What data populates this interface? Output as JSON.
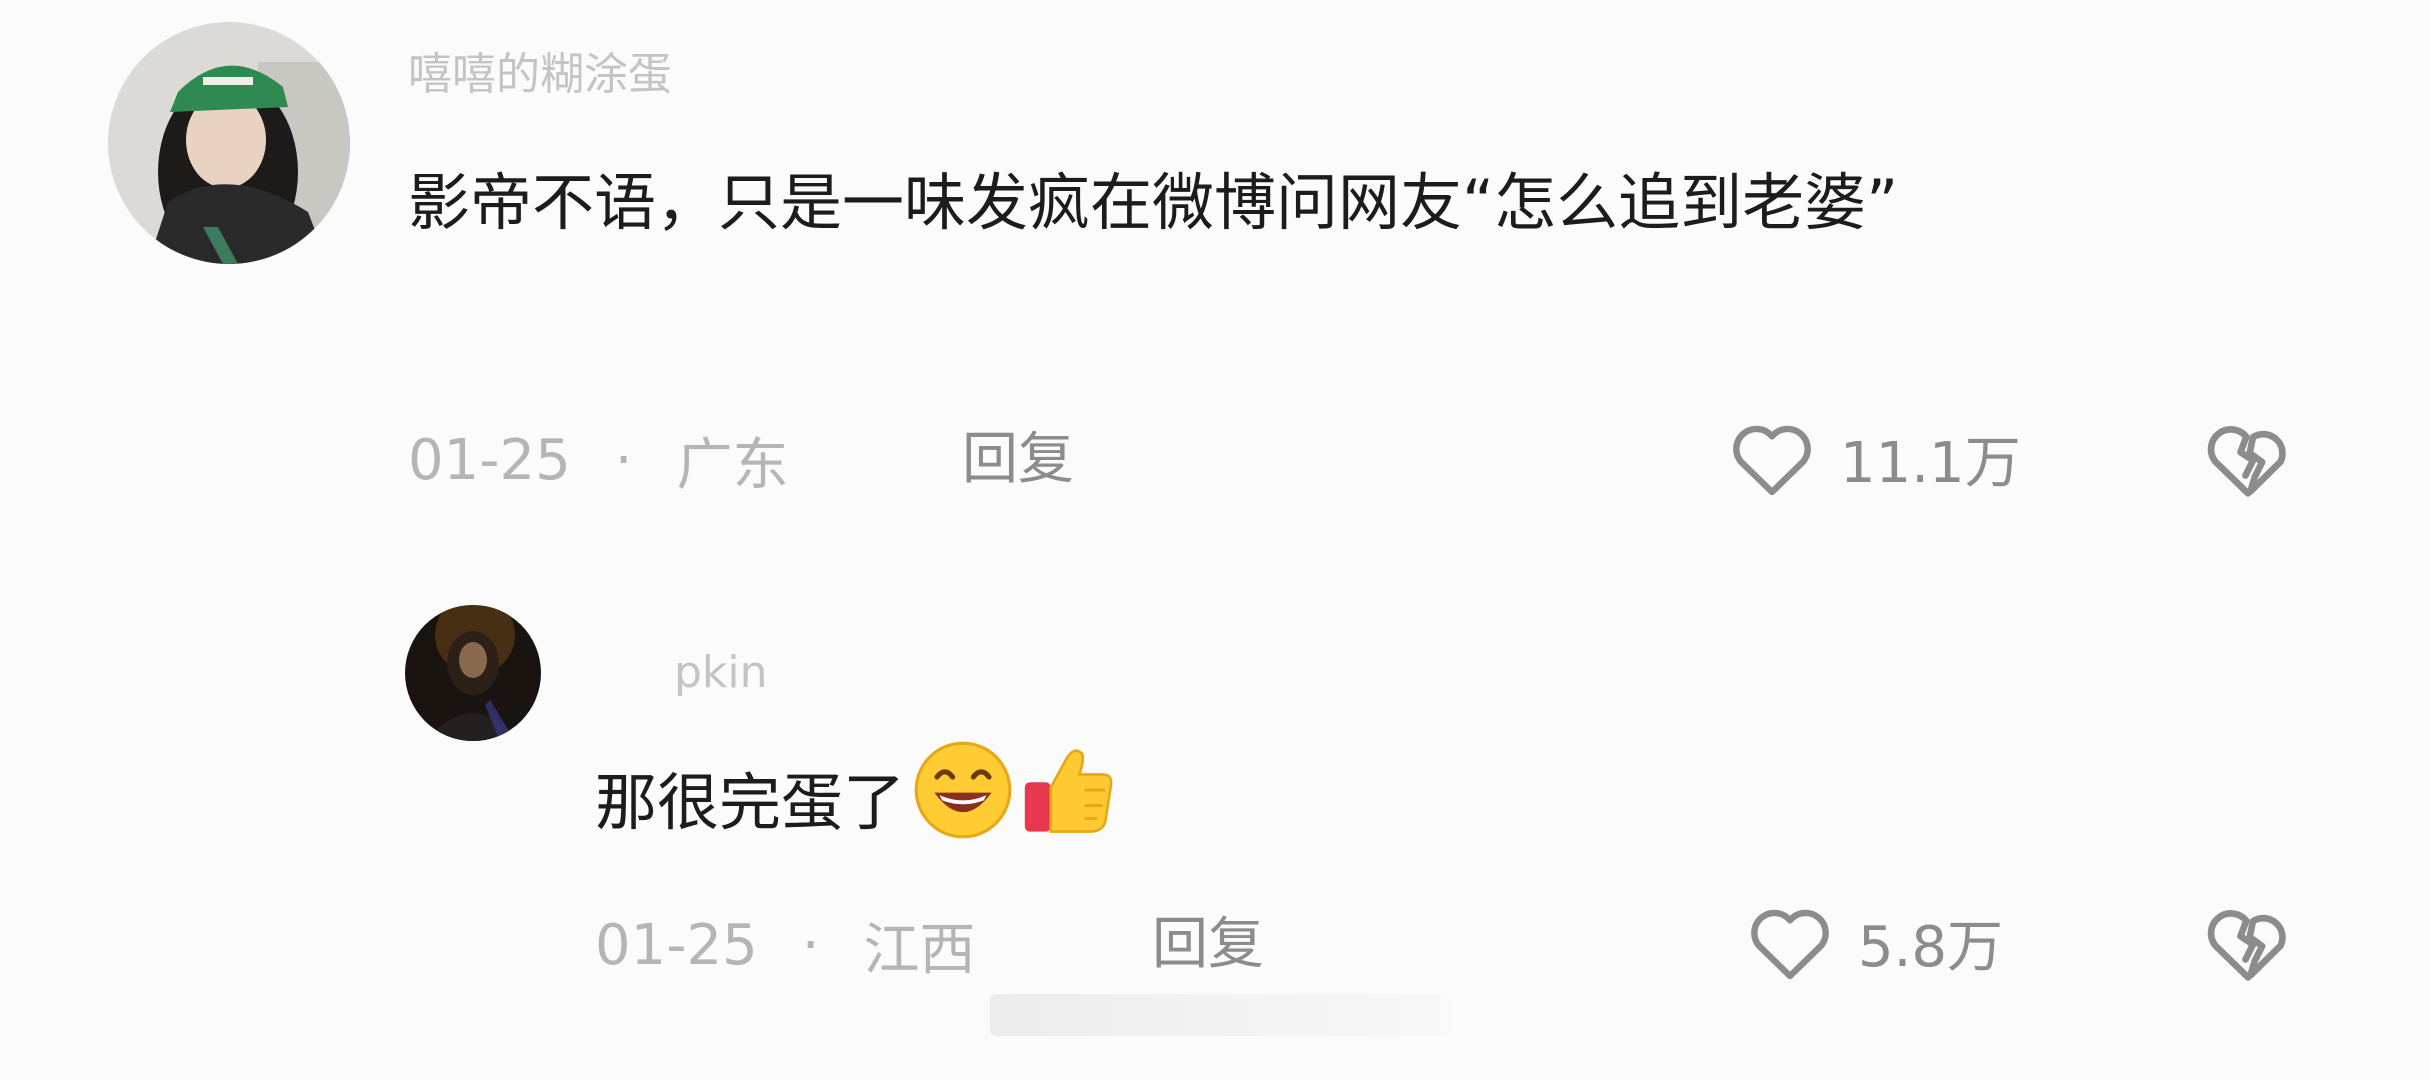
{
  "comments": [
    {
      "username": "嘻嘻的糊涂蛋",
      "text": "影帝不语，只是一味发疯在微博问网友“怎么追到老婆”",
      "date": "01-25",
      "separator": "·",
      "location": "广东",
      "reply_label": "回复",
      "likes": "11.1万",
      "avatar_icon": "user-avatar-green-cap"
    },
    {
      "username": "pkin",
      "text": "那很完蛋了",
      "emojis": [
        "grinning-face-emoji",
        "thumbs-up-emoji"
      ],
      "date": "01-25",
      "separator": "·",
      "location": "江西",
      "reply_label": "回复",
      "likes": "5.8万",
      "avatar_icon": "user-avatar-dark"
    }
  ],
  "icons": {
    "like": "heart-outline-icon",
    "dislike": "broken-heart-icon"
  },
  "colors": {
    "background": "#fbfbfb",
    "text": "#1c1c1c",
    "meta": "#b5b5b5",
    "action": "#8c8c8c"
  }
}
